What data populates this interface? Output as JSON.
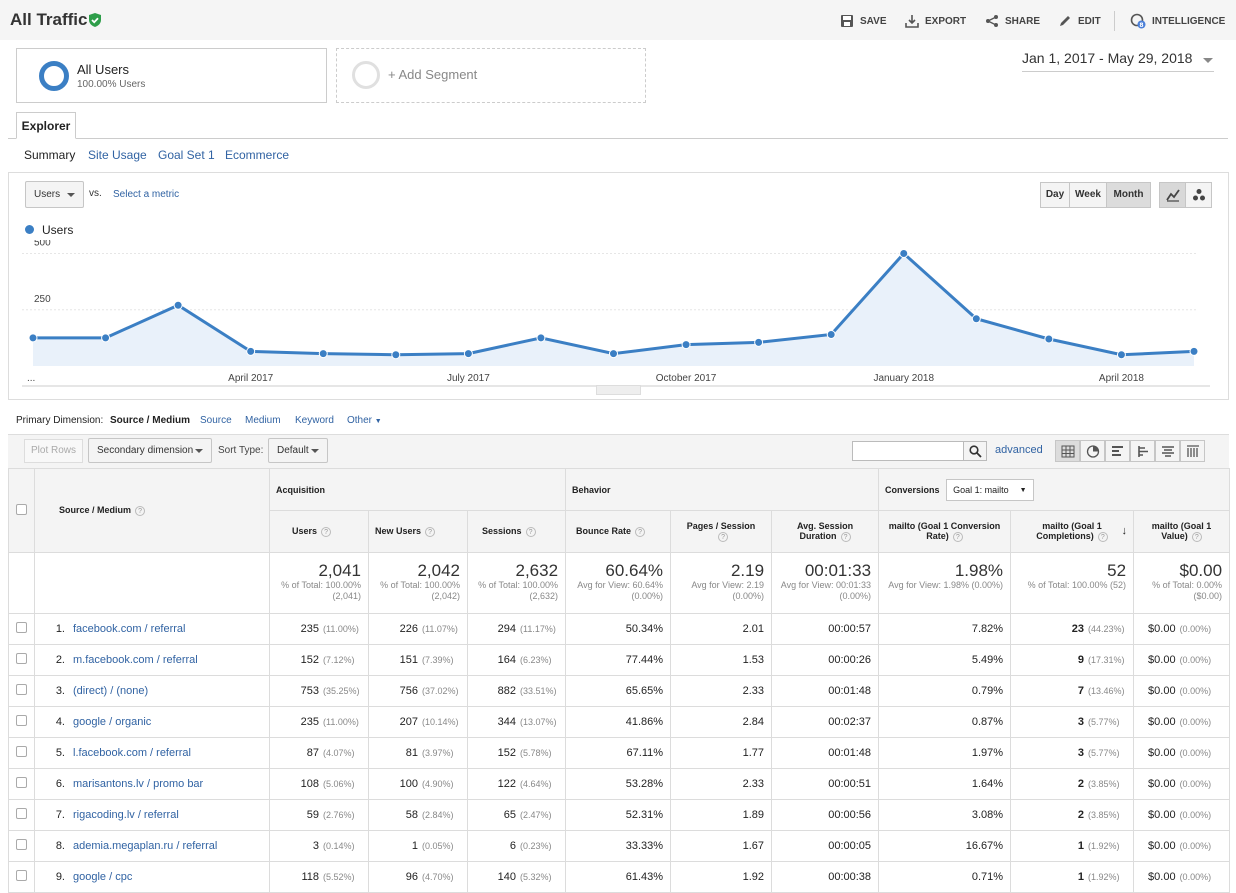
{
  "header": {
    "title": "All Traffic",
    "save": "SAVE",
    "export": "EXPORT",
    "share": "SHARE",
    "edit": "EDIT",
    "intelligence": "INTELLIGENCE",
    "intelligence_badge": "8"
  },
  "segments": {
    "all_users_title": "All Users",
    "all_users_sub": "100.00% Users",
    "add_segment": "+ Add Segment"
  },
  "date_range": "Jan 1, 2017 - May 29, 2018",
  "explorer": {
    "tab": "Explorer",
    "subtabs": [
      "Summary",
      "Site Usage",
      "Goal Set 1",
      "Ecommerce"
    ]
  },
  "chart_controls": {
    "metric": "Users",
    "vs": "vs.",
    "select_metric": "Select a metric",
    "periods": [
      "Day",
      "Week",
      "Month"
    ],
    "legend": "Users"
  },
  "chart_data": {
    "type": "line",
    "series": [
      {
        "name": "Users",
        "values": [
          125,
          125,
          270,
          65,
          55,
          50,
          55,
          125,
          55,
          95,
          105,
          140,
          500,
          210,
          120,
          50,
          65
        ],
        "color": "#3b7fc4"
      }
    ],
    "x_ticks": [
      "...",
      "April 2017",
      "July 2017",
      "October 2017",
      "January 2018",
      "April 2018"
    ],
    "y_ticks": [
      250,
      500
    ],
    "ylim": [
      0,
      560
    ],
    "grid": true
  },
  "primary_dimension": {
    "label": "Primary Dimension:",
    "active": "Source / Medium",
    "options": [
      "Source",
      "Medium",
      "Keyword",
      "Other"
    ]
  },
  "toolbar": {
    "plot_rows": "Plot Rows",
    "secondary_dimension": "Secondary dimension",
    "sort_type_label": "Sort Type:",
    "sort_type": "Default",
    "advanced": "advanced"
  },
  "table": {
    "dimension_header": "Source / Medium",
    "groups": {
      "acquisition": "Acquisition",
      "behavior": "Behavior",
      "conversions": "Conversions",
      "goal_select": "Goal 1: mailto"
    },
    "columns": [
      "Users",
      "New Users",
      "Sessions",
      "Bounce Rate",
      "Pages / Session",
      "Avg. Session Duration",
      "mailto (Goal 1 Conversion Rate)",
      "mailto (Goal 1 Completions)",
      "mailto (Goal 1 Value)"
    ],
    "totals": [
      {
        "value": "2,041",
        "sub": "% of Total: 100.00% (2,041)"
      },
      {
        "value": "2,042",
        "sub": "% of Total: 100.00% (2,042)"
      },
      {
        "value": "2,632",
        "sub": "% of Total: 100.00% (2,632)"
      },
      {
        "value": "60.64%",
        "sub": "Avg for View: 60.64% (0.00%)"
      },
      {
        "value": "2.19",
        "sub": "Avg for View: 2.19 (0.00%)"
      },
      {
        "value": "00:01:33",
        "sub": "Avg for View: 00:01:33 (0.00%)"
      },
      {
        "value": "1.98%",
        "sub": "Avg for View: 1.98% (0.00%)"
      },
      {
        "value": "52",
        "sub": "% of Total: 100.00% (52)"
      },
      {
        "value": "$0.00",
        "sub": "% of Total: 0.00% ($0.00)"
      }
    ],
    "rows": [
      {
        "n": "1.",
        "source": "facebook.com / referral",
        "users": "235",
        "users_pct": "(11.00%)",
        "new_users": "226",
        "new_users_pct": "(11.07%)",
        "sessions": "294",
        "sessions_pct": "(11.17%)",
        "bounce": "50.34%",
        "pages": "2.01",
        "duration": "00:00:57",
        "conv_rate": "7.82%",
        "completions": "23",
        "completions_pct": "(44.23%)",
        "value": "$0.00",
        "value_pct": "(0.00%)"
      },
      {
        "n": "2.",
        "source": "m.facebook.com / referral",
        "users": "152",
        "users_pct": "(7.12%)",
        "new_users": "151",
        "new_users_pct": "(7.39%)",
        "sessions": "164",
        "sessions_pct": "(6.23%)",
        "bounce": "77.44%",
        "pages": "1.53",
        "duration": "00:00:26",
        "conv_rate": "5.49%",
        "completions": "9",
        "completions_pct": "(17.31%)",
        "value": "$0.00",
        "value_pct": "(0.00%)"
      },
      {
        "n": "3.",
        "source": "(direct) / (none)",
        "users": "753",
        "users_pct": "(35.25%)",
        "new_users": "756",
        "new_users_pct": "(37.02%)",
        "sessions": "882",
        "sessions_pct": "(33.51%)",
        "bounce": "65.65%",
        "pages": "2.33",
        "duration": "00:01:48",
        "conv_rate": "0.79%",
        "completions": "7",
        "completions_pct": "(13.46%)",
        "value": "$0.00",
        "value_pct": "(0.00%)"
      },
      {
        "n": "4.",
        "source": "google / organic",
        "users": "235",
        "users_pct": "(11.00%)",
        "new_users": "207",
        "new_users_pct": "(10.14%)",
        "sessions": "344",
        "sessions_pct": "(13.07%)",
        "bounce": "41.86%",
        "pages": "2.84",
        "duration": "00:02:37",
        "conv_rate": "0.87%",
        "completions": "3",
        "completions_pct": "(5.77%)",
        "value": "$0.00",
        "value_pct": "(0.00%)"
      },
      {
        "n": "5.",
        "source": "l.facebook.com / referral",
        "users": "87",
        "users_pct": "(4.07%)",
        "new_users": "81",
        "new_users_pct": "(3.97%)",
        "sessions": "152",
        "sessions_pct": "(5.78%)",
        "bounce": "67.11%",
        "pages": "1.77",
        "duration": "00:01:48",
        "conv_rate": "1.97%",
        "completions": "3",
        "completions_pct": "(5.77%)",
        "value": "$0.00",
        "value_pct": "(0.00%)"
      },
      {
        "n": "6.",
        "source": "marisantons.lv / promo bar",
        "users": "108",
        "users_pct": "(5.06%)",
        "new_users": "100",
        "new_users_pct": "(4.90%)",
        "sessions": "122",
        "sessions_pct": "(4.64%)",
        "bounce": "53.28%",
        "pages": "2.33",
        "duration": "00:00:51",
        "conv_rate": "1.64%",
        "completions": "2",
        "completions_pct": "(3.85%)",
        "value": "$0.00",
        "value_pct": "(0.00%)"
      },
      {
        "n": "7.",
        "source": "rigacoding.lv / referral",
        "users": "59",
        "users_pct": "(2.76%)",
        "new_users": "58",
        "new_users_pct": "(2.84%)",
        "sessions": "65",
        "sessions_pct": "(2.47%)",
        "bounce": "52.31%",
        "pages": "1.89",
        "duration": "00:00:56",
        "conv_rate": "3.08%",
        "completions": "2",
        "completions_pct": "(3.85%)",
        "value": "$0.00",
        "value_pct": "(0.00%)"
      },
      {
        "n": "8.",
        "source": "ademia.megaplan.ru / referral",
        "users": "3",
        "users_pct": "(0.14%)",
        "new_users": "1",
        "new_users_pct": "(0.05%)",
        "sessions": "6",
        "sessions_pct": "(0.23%)",
        "bounce": "33.33%",
        "pages": "1.67",
        "duration": "00:00:05",
        "conv_rate": "16.67%",
        "completions": "1",
        "completions_pct": "(1.92%)",
        "value": "$0.00",
        "value_pct": "(0.00%)"
      },
      {
        "n": "9.",
        "source": "google / cpc",
        "users": "118",
        "users_pct": "(5.52%)",
        "new_users": "96",
        "new_users_pct": "(4.70%)",
        "sessions": "140",
        "sessions_pct": "(5.32%)",
        "bounce": "61.43%",
        "pages": "1.92",
        "duration": "00:00:38",
        "conv_rate": "0.71%",
        "completions": "1",
        "completions_pct": "(1.92%)",
        "value": "$0.00",
        "value_pct": "(0.00%)"
      }
    ]
  }
}
